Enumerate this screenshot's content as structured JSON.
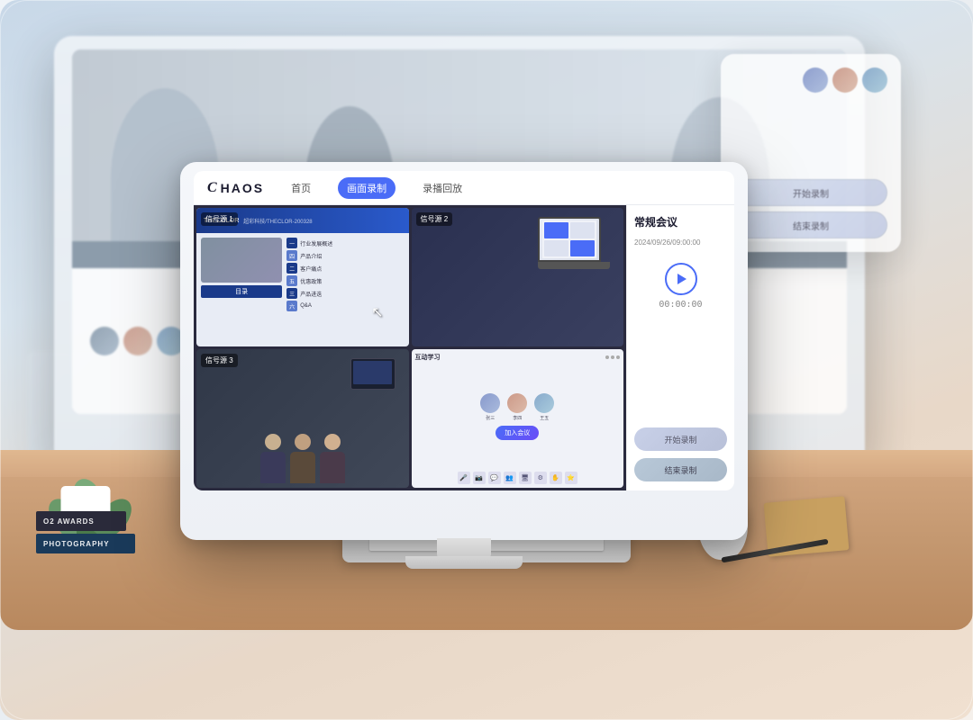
{
  "app": {
    "logo": "CHAOS",
    "logo_c": "C",
    "logo_rest": "HAOS",
    "nav": {
      "home": "首页",
      "screen_record": "画面录制",
      "playback": "录播回放"
    }
  },
  "meeting": {
    "title": "常规会议",
    "date": "2024/09/26/09:00:00",
    "time_display": "00:00:00"
  },
  "buttons": {
    "start_record": "开始录制",
    "end_record": "结束录制",
    "bg_start": "开始录制",
    "bg_end": "结束录制"
  },
  "video_cells": {
    "cell1_label": "信号源 1",
    "cell2_label": "信号源 2",
    "cell3_label": "信号源 3",
    "cell4_label": "互动学习"
  },
  "slide": {
    "brand": "THECOLOR",
    "subtitle": "超彩科技/THECLOR-200328",
    "menu_title": "目录",
    "items": [
      {
        "num": "一",
        "text": "行业发展概述"
      },
      {
        "num": "二",
        "text": "客户痛点"
      },
      {
        "num": "三",
        "text": "产品进迭"
      },
      {
        "num": "四",
        "text": "产品介绍"
      },
      {
        "num": "五",
        "text": "优惠政策"
      },
      {
        "num": "六",
        "text": "Q&A"
      }
    ]
  },
  "avatars": [
    {
      "label": "张三"
    },
    {
      "label": "李四"
    },
    {
      "label": "王五"
    }
  ],
  "bg_card": {
    "btns": [
      "开始录制",
      "结束录制"
    ]
  },
  "colors": {
    "primary": "#4a6cf7",
    "dark_bg": "#1a1a2e",
    "panel_bg": "#f0f2f8"
  }
}
